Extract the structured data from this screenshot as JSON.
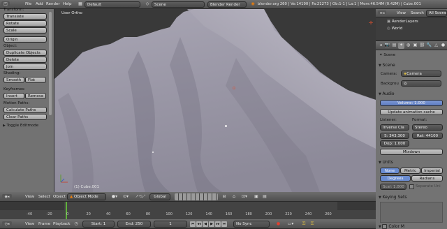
{
  "top_bar": {
    "menus": [
      "File",
      "Add",
      "Render",
      "Help"
    ],
    "layout": "Default",
    "scene": "Scene",
    "engine": "Blender Render",
    "stats": "blender.org 260 | Ve:14190 | Fa:21273 | Ob:1-1 | La:1 | Mem:46.54M (0.42M) | Cube.001"
  },
  "toolshelf": {
    "transform_header": "Transform:",
    "translate": "Translate",
    "rotate": "Rotate",
    "scale": "Scale",
    "origin": "Origin",
    "object_header": "Object:",
    "duplicate": "Duplicate Objects",
    "delete": "Delete",
    "join": "Join",
    "shading_header": "Shading:",
    "smooth": "Smooth",
    "flat": "Flat",
    "keyframes_header": "Keyframes:",
    "insert": "Insert",
    "remove": "Remove",
    "motion_header": "Motion Paths:",
    "calc_paths": "Calculate Paths",
    "clear_paths": "Clear Paths",
    "toggle_editmode": "Toggle Editmode"
  },
  "viewport": {
    "view_label": "User Ortho",
    "object_label": "(1) Cube.001"
  },
  "view3d_header": {
    "menus": [
      "View",
      "Select",
      "Object"
    ],
    "mode": "Object Mode",
    "orientation": "Global"
  },
  "timeline": {
    "ticks": [
      "-40",
      "-20",
      "0",
      "20",
      "40",
      "60",
      "80",
      "100",
      "120",
      "140",
      "160",
      "180",
      "200",
      "220",
      "240",
      "260"
    ],
    "menus": [
      "View",
      "Frame",
      "Playback"
    ],
    "start": "Start: 1",
    "end": "End: 250",
    "current": "1",
    "sync": "No Sync"
  },
  "outliner": {
    "menus": [
      "View",
      "Search"
    ],
    "filter": "All Scenes",
    "items": [
      "RenderLayers",
      "World"
    ]
  },
  "properties": {
    "breadcrumb": "Scene",
    "scene_panel": "Scene",
    "camera_label": "Camera:",
    "camera_value": "Camera",
    "background_label": "Backgrou",
    "audio_panel": "Audio",
    "volume": "Volume: 1.000",
    "update_cache": "Update animation cache",
    "listener_label": "Listener:",
    "format_label": "Format:",
    "listener_value": "Inverse Cla",
    "format_value": "Stereo",
    "speed": "S: 343.300",
    "rate": "Rat: 44100",
    "doppler": "Dop: 1.000",
    "mixdown": "Mixdown",
    "units_panel": "Units",
    "unit_none": "None",
    "unit_metric": "Metric",
    "unit_imperial": "Imperial",
    "degrees": "Degrees",
    "radians": "Radians",
    "scale": "Scal: 1.000",
    "separate_units": "Separate Uni",
    "keying_sets_panel": "Keying Sets",
    "color_management": "Color M"
  },
  "colors": {
    "accent": "#6a8cd0",
    "panel": "#737373",
    "header": "#5a5a5a"
  }
}
